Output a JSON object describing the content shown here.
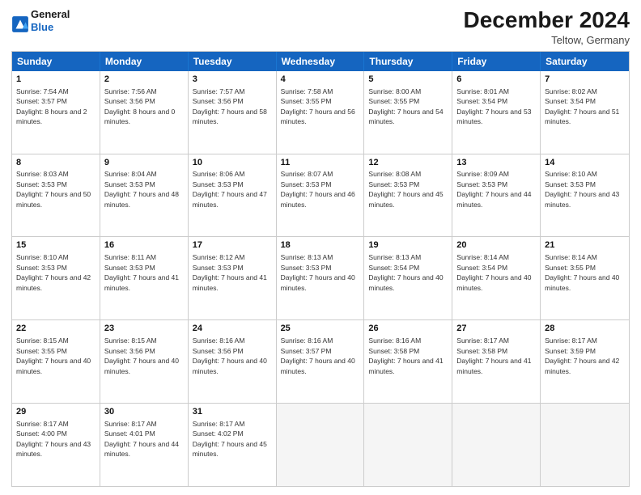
{
  "header": {
    "logo_line1": "General",
    "logo_line2": "Blue",
    "month": "December 2024",
    "location": "Teltow, Germany"
  },
  "days": [
    "Sunday",
    "Monday",
    "Tuesday",
    "Wednesday",
    "Thursday",
    "Friday",
    "Saturday"
  ],
  "weeks": [
    [
      {
        "num": "1",
        "sunrise": "7:54 AM",
        "sunset": "3:57 PM",
        "daylight": "8 hours and 2 minutes."
      },
      {
        "num": "2",
        "sunrise": "7:56 AM",
        "sunset": "3:56 PM",
        "daylight": "8 hours and 0 minutes."
      },
      {
        "num": "3",
        "sunrise": "7:57 AM",
        "sunset": "3:56 PM",
        "daylight": "7 hours and 58 minutes."
      },
      {
        "num": "4",
        "sunrise": "7:58 AM",
        "sunset": "3:55 PM",
        "daylight": "7 hours and 56 minutes."
      },
      {
        "num": "5",
        "sunrise": "8:00 AM",
        "sunset": "3:55 PM",
        "daylight": "7 hours and 54 minutes."
      },
      {
        "num": "6",
        "sunrise": "8:01 AM",
        "sunset": "3:54 PM",
        "daylight": "7 hours and 53 minutes."
      },
      {
        "num": "7",
        "sunrise": "8:02 AM",
        "sunset": "3:54 PM",
        "daylight": "7 hours and 51 minutes."
      }
    ],
    [
      {
        "num": "8",
        "sunrise": "8:03 AM",
        "sunset": "3:53 PM",
        "daylight": "7 hours and 50 minutes."
      },
      {
        "num": "9",
        "sunrise": "8:04 AM",
        "sunset": "3:53 PM",
        "daylight": "7 hours and 48 minutes."
      },
      {
        "num": "10",
        "sunrise": "8:06 AM",
        "sunset": "3:53 PM",
        "daylight": "7 hours and 47 minutes."
      },
      {
        "num": "11",
        "sunrise": "8:07 AM",
        "sunset": "3:53 PM",
        "daylight": "7 hours and 46 minutes."
      },
      {
        "num": "12",
        "sunrise": "8:08 AM",
        "sunset": "3:53 PM",
        "daylight": "7 hours and 45 minutes."
      },
      {
        "num": "13",
        "sunrise": "8:09 AM",
        "sunset": "3:53 PM",
        "daylight": "7 hours and 44 minutes."
      },
      {
        "num": "14",
        "sunrise": "8:10 AM",
        "sunset": "3:53 PM",
        "daylight": "7 hours and 43 minutes."
      }
    ],
    [
      {
        "num": "15",
        "sunrise": "8:10 AM",
        "sunset": "3:53 PM",
        "daylight": "7 hours and 42 minutes."
      },
      {
        "num": "16",
        "sunrise": "8:11 AM",
        "sunset": "3:53 PM",
        "daylight": "7 hours and 41 minutes."
      },
      {
        "num": "17",
        "sunrise": "8:12 AM",
        "sunset": "3:53 PM",
        "daylight": "7 hours and 41 minutes."
      },
      {
        "num": "18",
        "sunrise": "8:13 AM",
        "sunset": "3:53 PM",
        "daylight": "7 hours and 40 minutes."
      },
      {
        "num": "19",
        "sunrise": "8:13 AM",
        "sunset": "3:54 PM",
        "daylight": "7 hours and 40 minutes."
      },
      {
        "num": "20",
        "sunrise": "8:14 AM",
        "sunset": "3:54 PM",
        "daylight": "7 hours and 40 minutes."
      },
      {
        "num": "21",
        "sunrise": "8:14 AM",
        "sunset": "3:55 PM",
        "daylight": "7 hours and 40 minutes."
      }
    ],
    [
      {
        "num": "22",
        "sunrise": "8:15 AM",
        "sunset": "3:55 PM",
        "daylight": "7 hours and 40 minutes."
      },
      {
        "num": "23",
        "sunrise": "8:15 AM",
        "sunset": "3:56 PM",
        "daylight": "7 hours and 40 minutes."
      },
      {
        "num": "24",
        "sunrise": "8:16 AM",
        "sunset": "3:56 PM",
        "daylight": "7 hours and 40 minutes."
      },
      {
        "num": "25",
        "sunrise": "8:16 AM",
        "sunset": "3:57 PM",
        "daylight": "7 hours and 40 minutes."
      },
      {
        "num": "26",
        "sunrise": "8:16 AM",
        "sunset": "3:58 PM",
        "daylight": "7 hours and 41 minutes."
      },
      {
        "num": "27",
        "sunrise": "8:17 AM",
        "sunset": "3:58 PM",
        "daylight": "7 hours and 41 minutes."
      },
      {
        "num": "28",
        "sunrise": "8:17 AM",
        "sunset": "3:59 PM",
        "daylight": "7 hours and 42 minutes."
      }
    ],
    [
      {
        "num": "29",
        "sunrise": "8:17 AM",
        "sunset": "4:00 PM",
        "daylight": "7 hours and 43 minutes."
      },
      {
        "num": "30",
        "sunrise": "8:17 AM",
        "sunset": "4:01 PM",
        "daylight": "7 hours and 44 minutes."
      },
      {
        "num": "31",
        "sunrise": "8:17 AM",
        "sunset": "4:02 PM",
        "daylight": "7 hours and 45 minutes."
      },
      null,
      null,
      null,
      null
    ]
  ]
}
